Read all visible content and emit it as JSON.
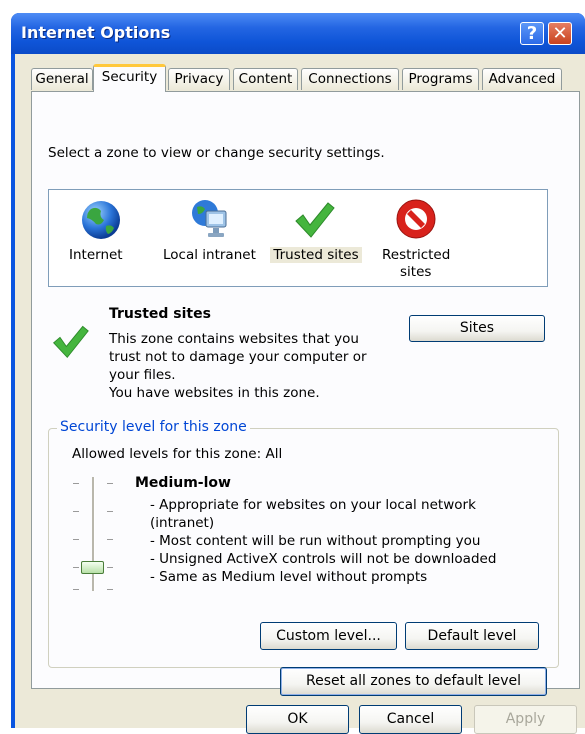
{
  "window": {
    "title": "Internet Options"
  },
  "titlebar": {
    "help_glyph": "?",
    "close_glyph": "✕"
  },
  "tabs": [
    "General",
    "Security",
    "Privacy",
    "Content",
    "Connections",
    "Programs",
    "Advanced"
  ],
  "active_tab": "Security",
  "zone_prompt": "Select a zone to view or change security settings.",
  "zones": [
    {
      "label": "Internet",
      "icon": "globe-icon"
    },
    {
      "label": "Local intranet",
      "icon": "local-intranet-icon"
    },
    {
      "label": "Trusted sites",
      "icon": "checkmark-icon"
    },
    {
      "label": "Restricted",
      "label2": "sites",
      "icon": "no-entry-icon"
    }
  ],
  "selected_zone": "Trusted sites",
  "zone_info": {
    "title": "Trusted sites",
    "lines": [
      "This zone contains websites that you",
      "trust not to damage your computer or",
      "your files.",
      "You have websites in this zone."
    ],
    "sites_button": "Sites"
  },
  "security_level": {
    "group_title": "Security level for this zone",
    "allowed": "Allowed levels for this zone: All",
    "level_name": "Medium-low",
    "bullets": [
      "- Appropriate for websites on your local network",
      "(intranet)",
      "- Most content will be run without prompting you",
      "- Unsigned ActiveX controls will not be downloaded",
      "- Same as Medium level without prompts"
    ],
    "custom_button": "Custom level...",
    "default_button": "Default level"
  },
  "reset_button": "Reset all zones to default level",
  "footer": {
    "ok": "OK",
    "cancel": "Cancel",
    "apply": "Apply"
  },
  "colors": {
    "title_blue": "#0a55e0",
    "dialog_bg": "#ece9d8",
    "group_title": "#0046d5",
    "tab_highlight": "#ffc83c"
  }
}
